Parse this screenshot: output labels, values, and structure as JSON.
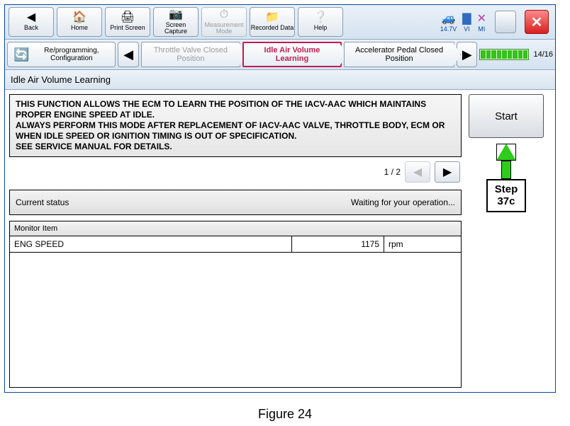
{
  "toolbar": {
    "back": "Back",
    "home": "Home",
    "print": "Print Screen",
    "capture": "Screen Capture",
    "measure": "Measurement Mode",
    "recorded": "Recorded Data",
    "help": "Help"
  },
  "status": {
    "voltage": "14.7V",
    "vi": "VI",
    "mi": "MI"
  },
  "breadcrumb": {
    "reprog": "Re/programming, Configuration",
    "prev": "Throttle Valve Closed Position",
    "active": "Idle Air Volume Learning",
    "next": "Accelerator Pedal Closed Position",
    "progress": "14/16"
  },
  "title": "Idle Air Volume Learning",
  "description": "THIS FUNCTION ALLOWS THE ECM TO LEARN THE POSITION OF THE IACV-AAC WHICH MAINTAINS PROPER ENGINE SPEED AT IDLE.\nALWAYS PERFORM THIS MODE AFTER REPLACEMENT OF IACV-AAC VALVE, THROTTLE BODY, ECM OR WHEN IDLE SPEED OR IGNITION TIMING IS OUT OF SPECIFICATION.\nSEE SERVICE MANUAL FOR DETAILS.",
  "pager": "1 / 2",
  "current_status_label": "Current status",
  "current_status_value": "Waiting for your operation...",
  "monitor_header": "Monitor Item",
  "monitor": {
    "name": "ENG SPEED",
    "value": "1175",
    "unit": "rpm"
  },
  "start_label": "Start",
  "callout": "Step\n37c",
  "figure": "Figure 24"
}
